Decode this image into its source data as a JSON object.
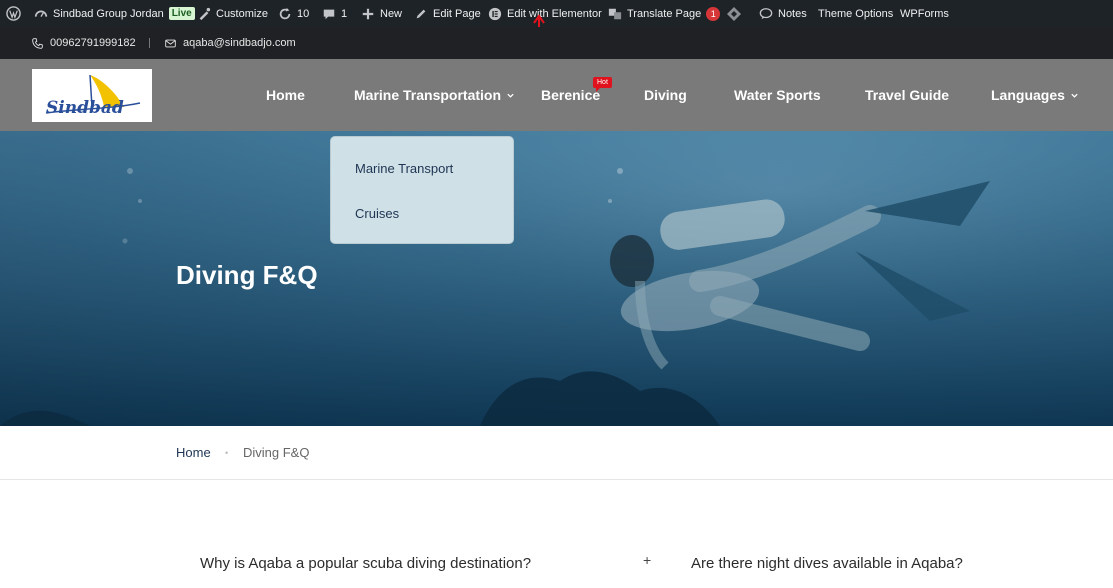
{
  "adminbar": {
    "site_name": "Sindbad Group Jordan",
    "live_badge": "Live",
    "customize": "Customize",
    "updates_count": "10",
    "comments_count": "1",
    "new": "New",
    "edit_page": "Edit Page",
    "edit_elementor": "Edit with Elementor",
    "translate_page": "Translate Page",
    "translate_count": "1",
    "notes": "Notes",
    "theme_options": "Theme Options",
    "wpforms": "WPForms"
  },
  "contact": {
    "phone": "00962791999182",
    "email": "aqaba@sindbadjo.com"
  },
  "logo": {
    "text": "Sindbad"
  },
  "nav": {
    "home": "Home",
    "marine": "Marine Transportation",
    "berenice": "Berenice",
    "hot": "Hot",
    "diving": "Diving",
    "water_sports": "Water Sports",
    "travel_guide": "Travel Guide",
    "languages": "Languages"
  },
  "dropdown": {
    "items": [
      "Marine Transport",
      "Cruises"
    ]
  },
  "hero": {
    "title": "Diving F&Q"
  },
  "breadcrumb": {
    "home": "Home",
    "current": "Diving F&Q"
  },
  "faq": {
    "q1": "Why is Aqaba a popular scuba diving destination?",
    "toggle": "+",
    "q2": "Are there night dives available in Aqaba?"
  },
  "colors": {
    "adminbar": "#1d2327",
    "nav_bg": "#7a7a7a",
    "hot_badge": "#e0121d",
    "dropdown_bg": "#cfe0e6",
    "hero_text": "#ffffff"
  }
}
